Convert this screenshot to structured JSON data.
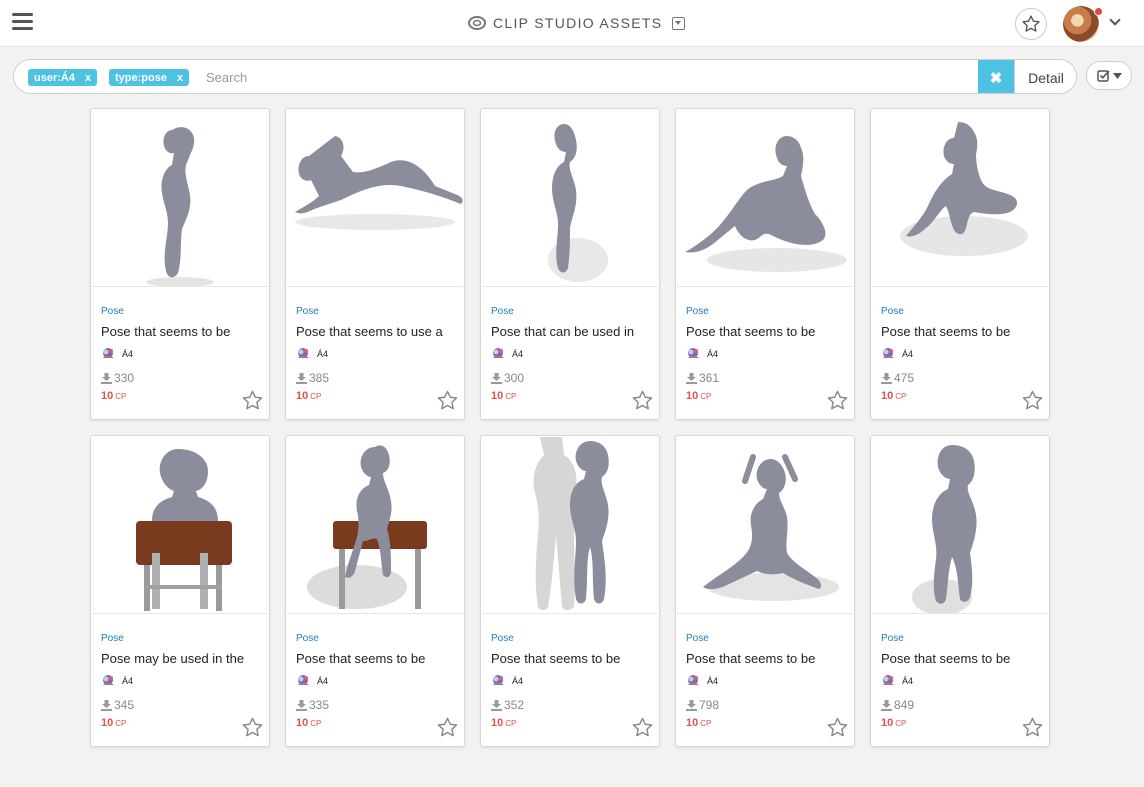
{
  "header": {
    "app_title": "CLIP STUDIO ASSETS",
    "menu_icon": "hamburger-menu-icon",
    "favorite_icon": "star-outline-icon"
  },
  "search": {
    "chips": [
      {
        "label": "user:Á4",
        "remove": "x"
      },
      {
        "label": "type:pose",
        "remove": "x"
      }
    ],
    "placeholder": "Search",
    "value": "",
    "clear_label": "✖",
    "detail_label": "Detail"
  },
  "colors": {
    "accent": "#4ec2e2",
    "link_blue": "#1d7fb8",
    "price_red": "#e0524c",
    "notification_dot": "#e8453c"
  },
  "cards": [
    {
      "type": "Pose",
      "title": "Pose that seems to be",
      "author": "Á4",
      "downloads": "330",
      "price": "10",
      "unit": "CP"
    },
    {
      "type": "Pose",
      "title": "Pose that seems to use a",
      "author": "Á4",
      "downloads": "385",
      "price": "10",
      "unit": "CP"
    },
    {
      "type": "Pose",
      "title": "Pose that can be used in",
      "author": "Á4",
      "downloads": "300",
      "price": "10",
      "unit": "CP"
    },
    {
      "type": "Pose",
      "title": "Pose that seems to be",
      "author": "Á4",
      "downloads": "361",
      "price": "10",
      "unit": "CP"
    },
    {
      "type": "Pose",
      "title": "Pose that seems to be",
      "author": "Á4",
      "downloads": "475",
      "price": "10",
      "unit": "CP"
    },
    {
      "type": "Pose",
      "title": "Pose may be used in the",
      "author": "Á4",
      "downloads": "345",
      "price": "10",
      "unit": "CP"
    },
    {
      "type": "Pose",
      "title": "Pose that seems to be",
      "author": "Á4",
      "downloads": "335",
      "price": "10",
      "unit": "CP"
    },
    {
      "type": "Pose",
      "title": "Pose that seems to be",
      "author": "Á4",
      "downloads": "352",
      "price": "10",
      "unit": "CP"
    },
    {
      "type": "Pose",
      "title": "Pose that seems to be",
      "author": "Á4",
      "downloads": "798",
      "price": "10",
      "unit": "CP"
    },
    {
      "type": "Pose",
      "title": "Pose that seems to be",
      "author": "Á4",
      "downloads": "849",
      "price": "10",
      "unit": "CP"
    }
  ]
}
